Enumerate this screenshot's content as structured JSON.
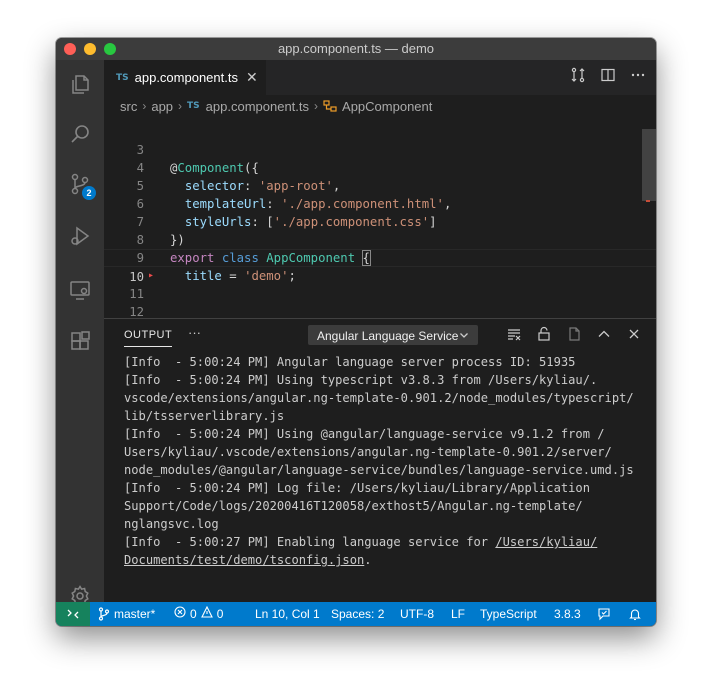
{
  "window": {
    "title": "app.component.ts — demo"
  },
  "activity_bar": {
    "scm_badge": "2"
  },
  "tab": {
    "lang_badge": "TS",
    "label": "app.component.ts",
    "close_glyph": "✕"
  },
  "breadcrumb": {
    "parts": [
      "src",
      "app",
      "app.component.ts",
      "AppComponent"
    ],
    "file_badge": "TS"
  },
  "editor": {
    "lines": [
      {
        "num": "3",
        "code": "@Component({"
      },
      {
        "num": "4",
        "code": "  selector: 'app-root',"
      },
      {
        "num": "5",
        "code": "  templateUrl: './app.component.html',"
      },
      {
        "num": "6",
        "code": "  styleUrls: ['./app.component.css']"
      },
      {
        "num": "7",
        "code": "})"
      },
      {
        "num": "8",
        "code": "export class AppComponent {"
      },
      {
        "num": "9",
        "code": "  title = 'demo';"
      },
      {
        "num": "10",
        "code": ""
      },
      {
        "num": "11",
        "code": "}"
      },
      {
        "num": "12",
        "code": ""
      }
    ],
    "current_line": "10"
  },
  "panel": {
    "title": "OUTPUT",
    "more": "···",
    "channel": "Angular Language Service",
    "output_lines": [
      "[Info  - 5:00:24 PM] Angular language server process ID: 51935",
      "[Info  - 5:00:24 PM] Using typescript v3.8.3 from /Users/kyliau/.",
      "vscode/extensions/angular.ng-template-0.901.2/node_modules/typescript/",
      "lib/tsserverlibrary.js",
      "[Info  - 5:00:24 PM] Using @angular/language-service v9.1.2 from /",
      "Users/kyliau/.vscode/extensions/angular.ng-template-0.901.2/server/",
      "node_modules/@angular/language-service/bundles/language-service.umd.js",
      "[Info  - 5:00:24 PM] Log file: /Users/kyliau/Library/Application",
      "Support/Code/logs/20200416T120058/exthost5/Angular.ng-template/",
      "nglangsvc.log"
    ],
    "last_prefix": "[Info  - 5:00:27 PM] Enabling language service for ",
    "last_link_a": "/Users/kyliau/",
    "last_link_b": "Documents/test/demo/tsconfig.json",
    "last_suffix": "."
  },
  "statusbar": {
    "branch": "master*",
    "errors": "0",
    "warnings": "0",
    "position": "Ln 10, Col 1",
    "spaces": "Spaces: 2",
    "encoding": "UTF-8",
    "eol": "LF",
    "language": "TypeScript",
    "version": "3.8.3"
  },
  "colors": {
    "statusbar": "#007acc",
    "remote": "#16825d",
    "activity_bar": "#333333",
    "editor_bg": "#1e1e1e"
  }
}
